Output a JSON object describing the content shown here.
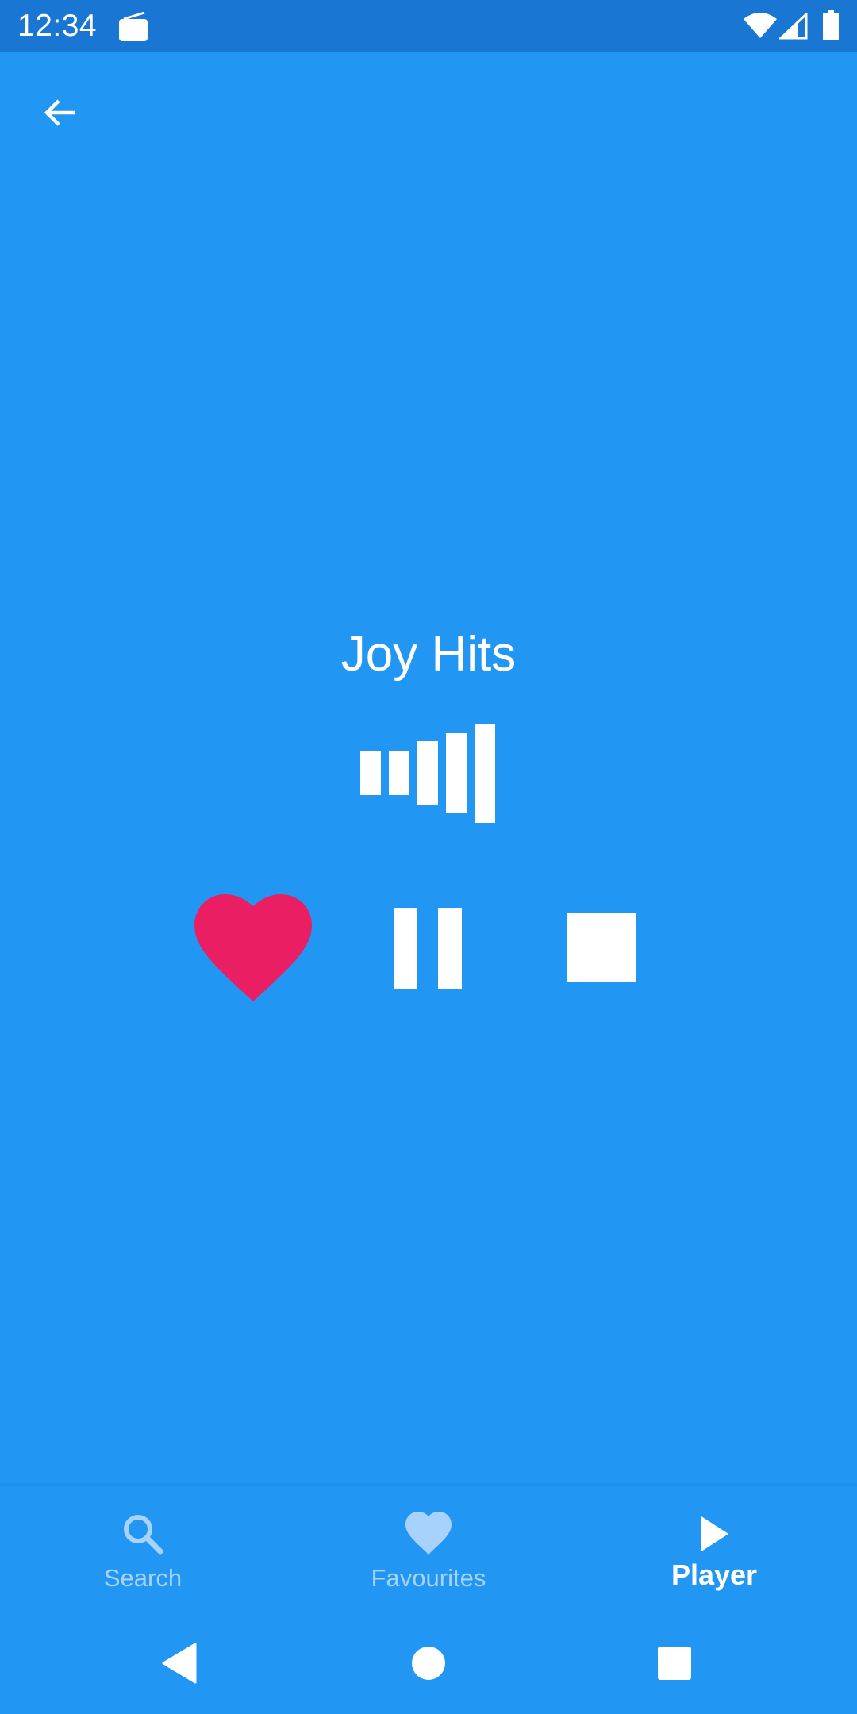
{
  "status_bar": {
    "time": "12:34",
    "icons": [
      "radio-icon",
      "wifi-icon",
      "signal-icon",
      "battery-icon"
    ]
  },
  "toolbar": {
    "back_icon": "arrow-back-icon"
  },
  "player": {
    "station_name": "Joy Hits",
    "equalizer_icon": "equalizer-icon",
    "favourite_icon": "heart-icon",
    "pause_icon": "pause-icon",
    "stop_icon": "stop-icon"
  },
  "bottom_nav": {
    "items": [
      {
        "label": "Search",
        "icon": "search-icon",
        "active": false
      },
      {
        "label": "Favourites",
        "icon": "heart-icon",
        "active": false
      },
      {
        "label": "Player",
        "icon": "play-icon",
        "active": true
      }
    ]
  },
  "system_nav": {
    "icons": [
      "back-triangle-icon",
      "home-circle-icon",
      "recents-square-icon"
    ]
  },
  "colors": {
    "background": "#2196F3",
    "status_bar": "#1976D2",
    "favourite_active": "#E91E63",
    "nav_inactive": "#A7D3FA",
    "foreground": "#FFFFFF"
  }
}
